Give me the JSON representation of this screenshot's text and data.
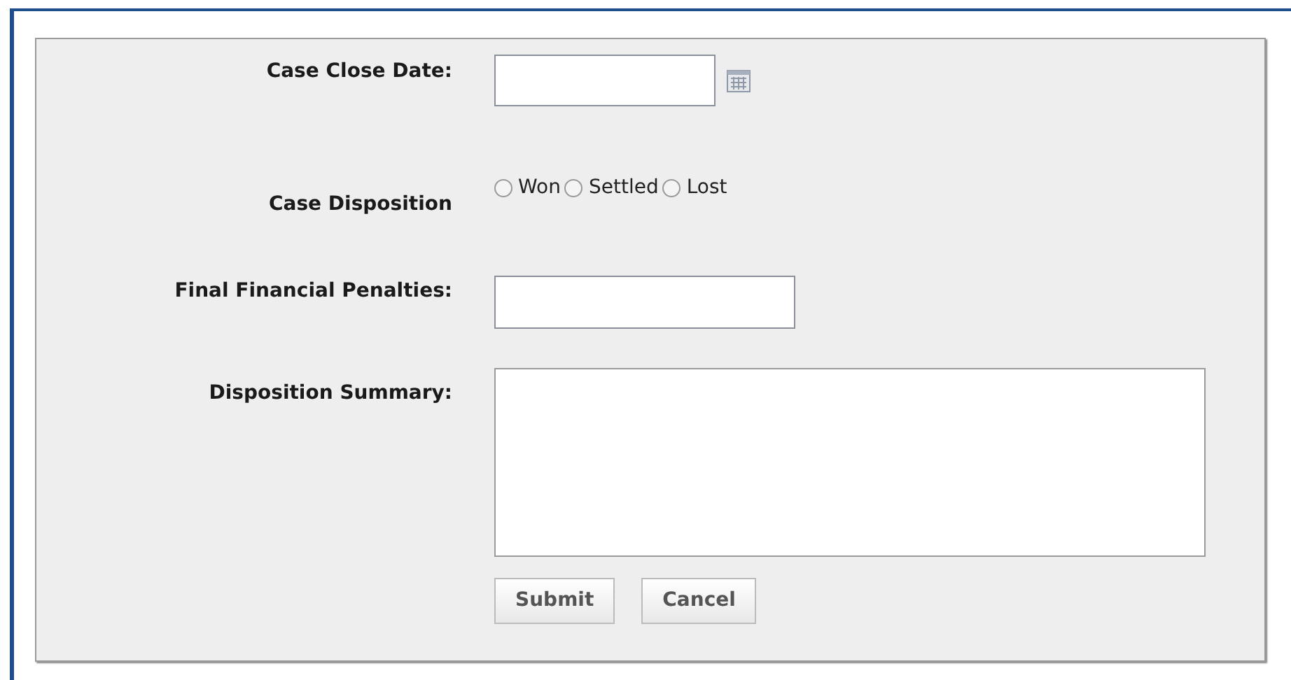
{
  "form": {
    "fields": [
      {
        "kind": "date",
        "label": "Case Close Date:"
      },
      {
        "kind": "radio",
        "label": "Case Disposition",
        "options": [
          {
            "label": "Won",
            "selected": false
          },
          {
            "label": "Settled",
            "selected": false
          },
          {
            "label": "Lost",
            "selected": false
          }
        ]
      },
      {
        "kind": "text",
        "label": "Final Financial Penalties:"
      },
      {
        "kind": "textarea",
        "label": "Disposition Summary:"
      }
    ],
    "buttons": [
      "Submit",
      "Cancel"
    ]
  }
}
